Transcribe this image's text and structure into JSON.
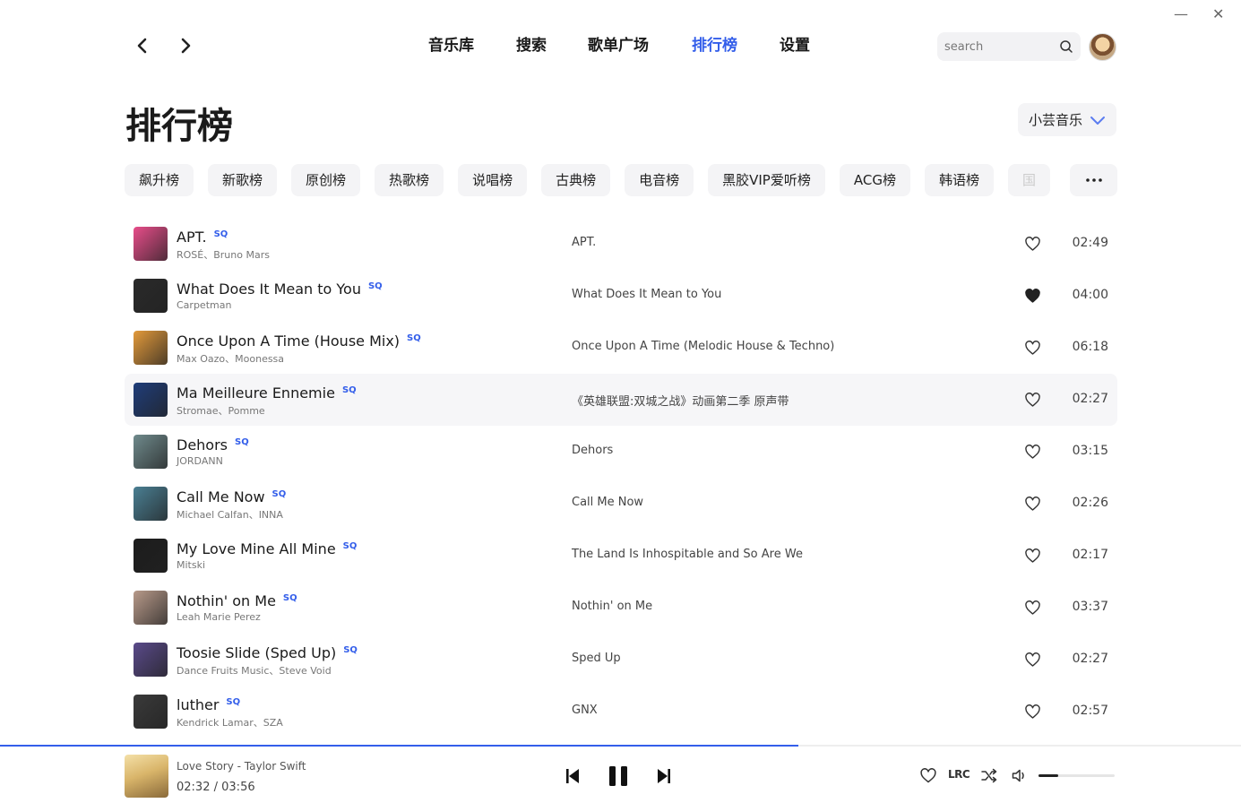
{
  "window": {
    "minimize_glyph": "—",
    "close_glyph": "✕"
  },
  "nav": {
    "back_icon": "chevron-left-icon",
    "forward_icon": "chevron-right-icon",
    "tabs": [
      {
        "label": "音乐库",
        "active": false
      },
      {
        "label": "搜索",
        "active": false
      },
      {
        "label": "歌单广场",
        "active": false
      },
      {
        "label": "排行榜",
        "active": true
      },
      {
        "label": "设置",
        "active": false
      }
    ],
    "search_placeholder": "search",
    "accent_color": "#335eea"
  },
  "page": {
    "title": "排行榜",
    "source_label": "小芸音乐"
  },
  "categories": [
    "飙升榜",
    "新歌榜",
    "原创榜",
    "热歌榜",
    "说唱榜",
    "古典榜",
    "电音榜",
    "黑胶VIP爱听榜",
    "ACG榜",
    "韩语榜",
    "国"
  ],
  "songs": [
    {
      "title": "APT.",
      "quality": "SQ",
      "artist": "ROSÉ、Bruno Mars",
      "album": "APT.",
      "liked": false,
      "duration": "02:49",
      "cover_color": "#e84d8a"
    },
    {
      "title": "What Does It Mean to You",
      "quality": "SQ",
      "artist": "Carpetman",
      "album": "What Does It Mean to You",
      "liked": true,
      "duration": "04:00",
      "cover_color": "#2a2a2a"
    },
    {
      "title": "Once Upon A Time (House Mix)",
      "quality": "SQ",
      "artist": "Max Oazo、Moonessa",
      "album": "Once Upon A Time (Melodic House & Techno)",
      "liked": false,
      "duration": "06:18",
      "cover_color": "#e39a3b"
    },
    {
      "title": "Ma Meilleure Ennemie",
      "quality": "SQ",
      "artist": "Stromae、Pomme",
      "album": "《英雄联盟:双城之战》动画第二季 原声带",
      "liked": false,
      "duration": "02:27",
      "cover_color": "#1f3d7a"
    },
    {
      "title": "Dehors",
      "quality": "SQ",
      "artist": "JORDANN",
      "album": "Dehors",
      "liked": false,
      "duration": "03:15",
      "cover_color": "#6f8a8c"
    },
    {
      "title": "Call Me Now",
      "quality": "SQ",
      "artist": "Michael Calfan、INNA",
      "album": "Call Me Now",
      "liked": false,
      "duration": "02:26",
      "cover_color": "#4a7f93"
    },
    {
      "title": "My Love Mine All Mine",
      "quality": "SQ",
      "artist": "Mitski",
      "album": "The Land Is Inhospitable and So Are We",
      "liked": false,
      "duration": "02:17",
      "cover_color": "#1c1c1c"
    },
    {
      "title": "Nothin' on Me",
      "quality": "SQ",
      "artist": "Leah Marie Perez",
      "album": "Nothin' on Me",
      "liked": false,
      "duration": "03:37",
      "cover_color": "#b89a8a"
    },
    {
      "title": "Toosie Slide (Sped Up)",
      "quality": "SQ",
      "artist": "Dance Fruits Music、Steve Void",
      "album": "Sped Up",
      "liked": false,
      "duration": "02:27",
      "cover_color": "#5a4a8a"
    },
    {
      "title": "luther",
      "quality": "SQ",
      "artist": "Kendrick Lamar、SZA",
      "album": "GNX",
      "liked": false,
      "duration": "02:57",
      "cover_color": "#3a3a3a"
    }
  ],
  "player": {
    "now_playing": "Love Story - Taylor Swift",
    "current_time": "02:32",
    "separator": "/",
    "total_time": "03:56",
    "progress_fraction": 0.643,
    "volume_fraction": 0.26,
    "lrc_label": "LRC"
  }
}
